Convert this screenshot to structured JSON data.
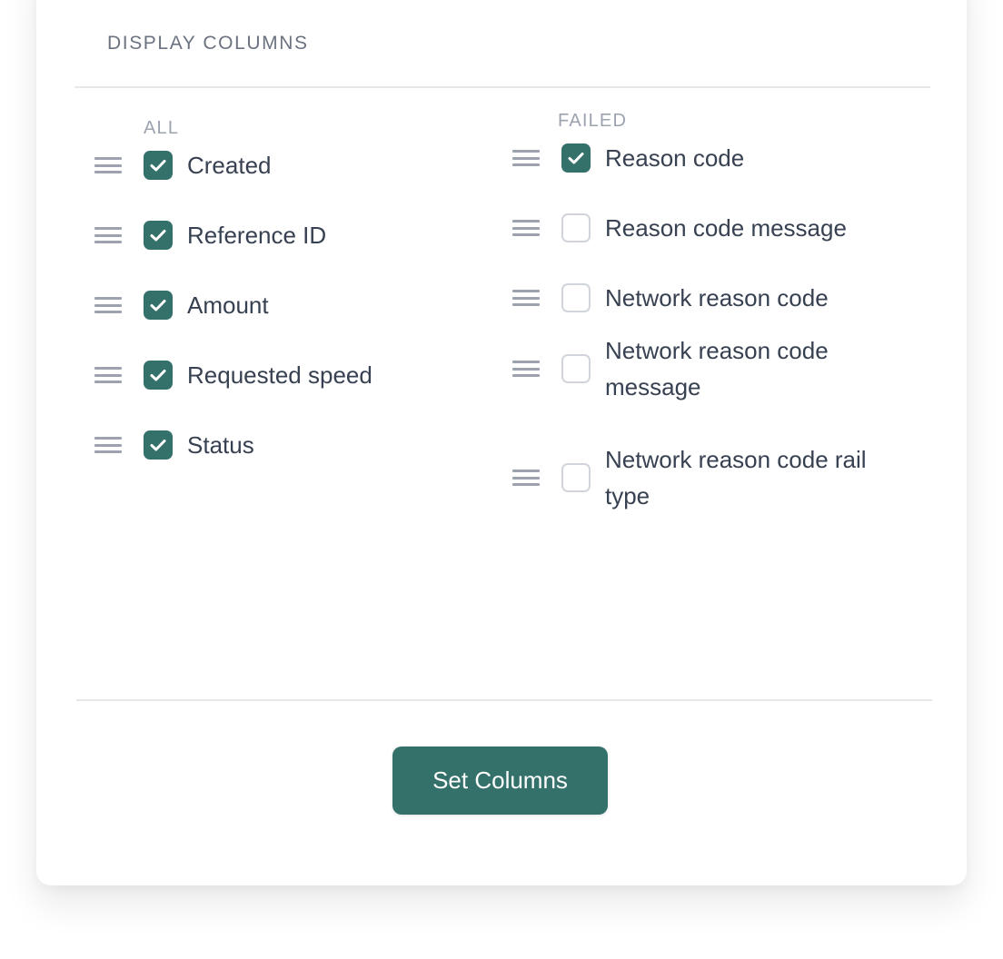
{
  "panel": {
    "title": "DISPLAY COLUMNS",
    "accent_color": "#35716b"
  },
  "groups": [
    {
      "header": "ALL",
      "columns": [
        {
          "label": "Created",
          "checked": true
        },
        {
          "label": "Reference ID",
          "checked": true
        },
        {
          "label": "Amount",
          "checked": true
        },
        {
          "label": "Requested speed",
          "checked": true
        },
        {
          "label": "Status",
          "checked": true
        }
      ]
    },
    {
      "header": "FAILED",
      "columns": [
        {
          "label": "Reason code",
          "checked": true
        },
        {
          "label": "Reason code message",
          "checked": false
        },
        {
          "label": "Network reason code",
          "checked": false
        },
        {
          "label": "Network reason code message",
          "checked": false
        },
        {
          "label": "Network reason code rail type",
          "checked": false
        }
      ]
    }
  ],
  "actions": {
    "set_columns_label": "Set Columns"
  },
  "icons": {
    "drag_handle": "drag-handle-icon",
    "check": "checkmark-icon"
  }
}
